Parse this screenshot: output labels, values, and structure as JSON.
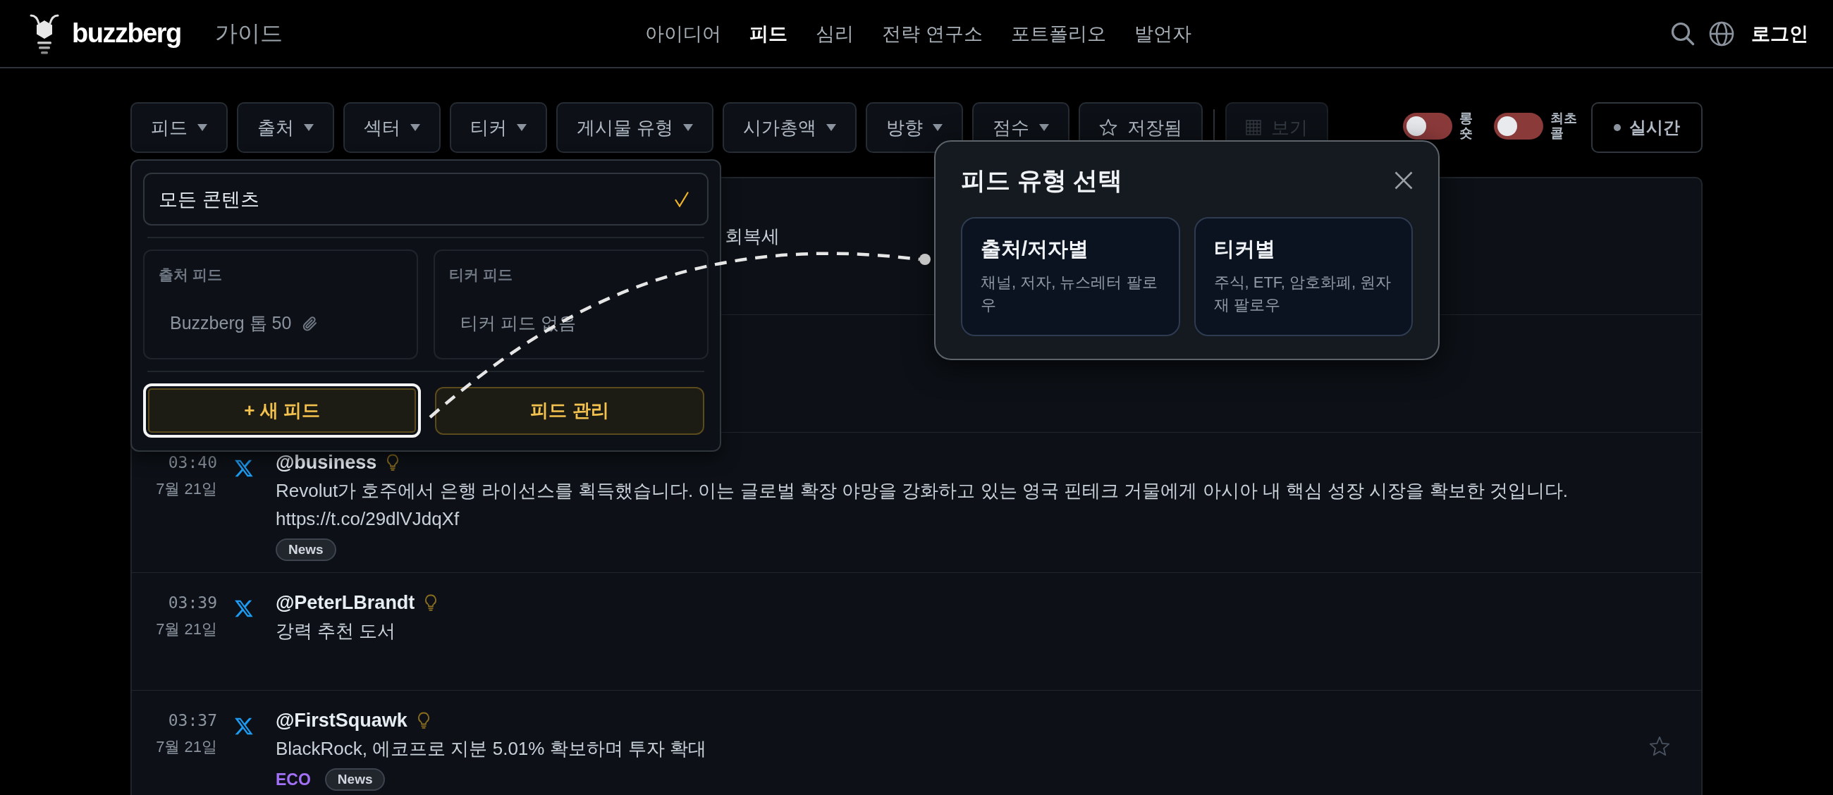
{
  "header": {
    "logo": "buzzberg",
    "guide": "가이드",
    "nav": [
      {
        "label": "아이디어",
        "selected": false
      },
      {
        "label": "피드",
        "selected": true
      },
      {
        "label": "심리",
        "selected": false
      },
      {
        "label": "전략 연구소",
        "selected": false
      },
      {
        "label": "포트폴리오",
        "selected": false
      },
      {
        "label": "발언자",
        "selected": false
      }
    ],
    "login": "로그인"
  },
  "filters": {
    "dropdowns": [
      "피드",
      "출처",
      "섹터",
      "티커",
      "게시물 유형",
      "시가총액",
      "방향",
      "점수"
    ],
    "saved": "저장됨",
    "view": {
      "label": "보기",
      "disabled": true
    },
    "toggles": [
      {
        "label": "롱숏",
        "on": false
      },
      {
        "label": "최초콜",
        "on": false
      }
    ],
    "live": "실시간"
  },
  "feed_menu": {
    "all": {
      "label": "모든 콘텐츠",
      "selected": true
    },
    "groups": [
      {
        "title": "출처 피드",
        "items": [
          "Buzzberg 톱 50"
        ]
      },
      {
        "title": "티커 피드",
        "empty": "티커 피드 없음"
      }
    ],
    "buttons": [
      {
        "label": "+ 새 피드",
        "focused": true
      },
      {
        "label": "피드 관리",
        "focused": false
      }
    ]
  },
  "feed_type_dialog": {
    "title": "피드 유형 선택",
    "options": [
      {
        "title": "출처/저자별",
        "description": "채널, 저자, 뉴스레터 팔로우"
      },
      {
        "title": "티커별",
        "description": "주식, ETF, 암호화폐, 원자재 팔로우"
      }
    ]
  },
  "feed": {
    "rows": [
      {
        "kind": "covered",
        "text": "회복세"
      },
      {
        "kind": "covered"
      },
      {
        "kind": "post",
        "time": "03:40",
        "date": "7월 21일",
        "author": "@business",
        "text": "Revolut가 호주에서 은행 라이선스를 획득했습니다. 이는 글로벌 확장 야망을 강화하고 있는 영국 핀테크 거물에게 아시아 내 핵심 성장 시장을 확보한 것입니다.",
        "url": "https://t.co/29dlVJdqXf",
        "tags": [
          {
            "kind": "category",
            "label": "News"
          }
        ]
      },
      {
        "kind": "post",
        "time": "03:39",
        "date": "7월 21일",
        "author": "@PeterLBrandt",
        "text": "강력 추천 도서"
      },
      {
        "kind": "post",
        "time": "03:37",
        "date": "7월 21일",
        "author": "@FirstSquawk",
        "text": "BlackRock, 에코프로 지분 5.01% 확보하며 투자 확대",
        "tags": [
          {
            "kind": "ticker",
            "label": "ECO"
          },
          {
            "kind": "category",
            "label": "News"
          }
        ],
        "saved": false
      }
    ]
  }
}
